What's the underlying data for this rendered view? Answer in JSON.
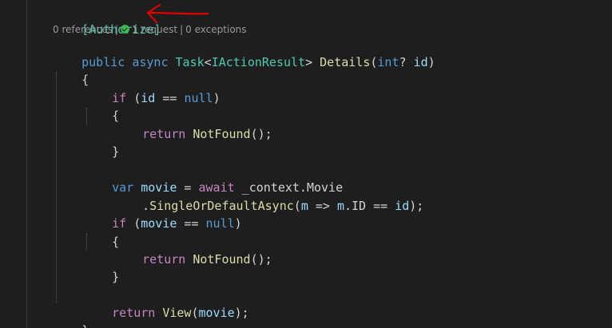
{
  "editor": {
    "top_partial": "",
    "attribute": "[Authorize]",
    "codelens": {
      "references": "0 references",
      "requests": "1 request",
      "exceptions": "0 exceptions"
    },
    "signature": {
      "public": "public",
      "async": "async",
      "task": "Task",
      "lt": "<",
      "iaction": "IActionResult",
      "gt": ">",
      "method": "Details",
      "open": "(",
      "int": "int",
      "q": "? ",
      "param": "id",
      "close": ")"
    },
    "brace_open": "{",
    "if1": {
      "kw": "if",
      "open": " (",
      "var": "id",
      "op": " == ",
      "null": "null",
      "close": ")"
    },
    "inner_open_1": "{",
    "return1": {
      "kw": "return",
      "method": "NotFound",
      "tail": "();"
    },
    "inner_close_1": "}",
    "var_line": {
      "kw": "var",
      "name": "movie",
      "eq": " = ",
      "await": "await",
      "ctx": " _context.Movie"
    },
    "linq_line": {
      "dot": ".",
      "method": "SingleOrDefaultAsync",
      "open": "(",
      "m1": "m",
      "arrow": " => ",
      "m2": "m",
      "prop": ".ID == ",
      "id": "id",
      "close": ");"
    },
    "if2": {
      "kw": "if",
      "open": " (",
      "var": "movie",
      "op": " == ",
      "null": "null",
      "close": ")"
    },
    "inner_open_2": "{",
    "return2": {
      "kw": "return",
      "method": "NotFound",
      "tail": "();"
    },
    "inner_close_2": "}",
    "return3": {
      "kw": "return",
      "method": "View",
      "open": "(",
      "arg": "movie",
      "close": ");"
    },
    "brace_close": "}"
  },
  "colors": {
    "background": "#1e1e1e",
    "keyword": "#569cd6",
    "control": "#c586c0",
    "type": "#4ec9b0",
    "method": "#dcdcaa",
    "variable": "#9cdcfe",
    "annotation_arrow": "#e00000"
  }
}
